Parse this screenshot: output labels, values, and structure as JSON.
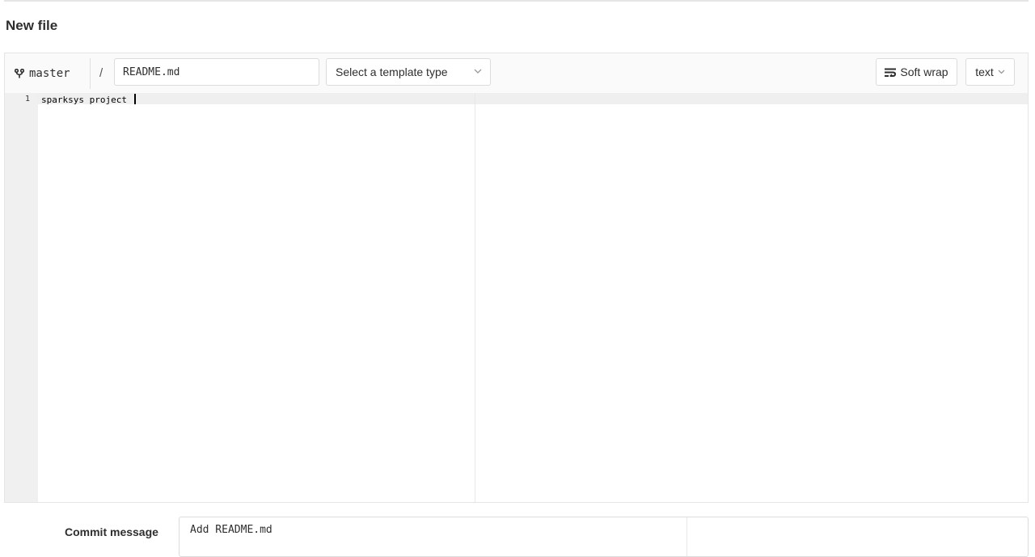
{
  "page": {
    "title": "New file"
  },
  "toolbar": {
    "branch": "master",
    "path_separator": "/",
    "file_name": "README.md",
    "template_placeholder": "Select a template type",
    "soft_wrap_label": "Soft wrap",
    "mode_label": "text",
    "icons": {
      "branch": "git-branch-icon",
      "template_dropdown": "chevron-down-icon",
      "soft_wrap": "soft-wrap-icon",
      "mode_dropdown": "chevron-down-icon"
    }
  },
  "editor": {
    "lines": [
      {
        "number": "1",
        "text": "sparksys project "
      }
    ]
  },
  "commit": {
    "label": "Commit message",
    "message": "Add README.md"
  }
}
